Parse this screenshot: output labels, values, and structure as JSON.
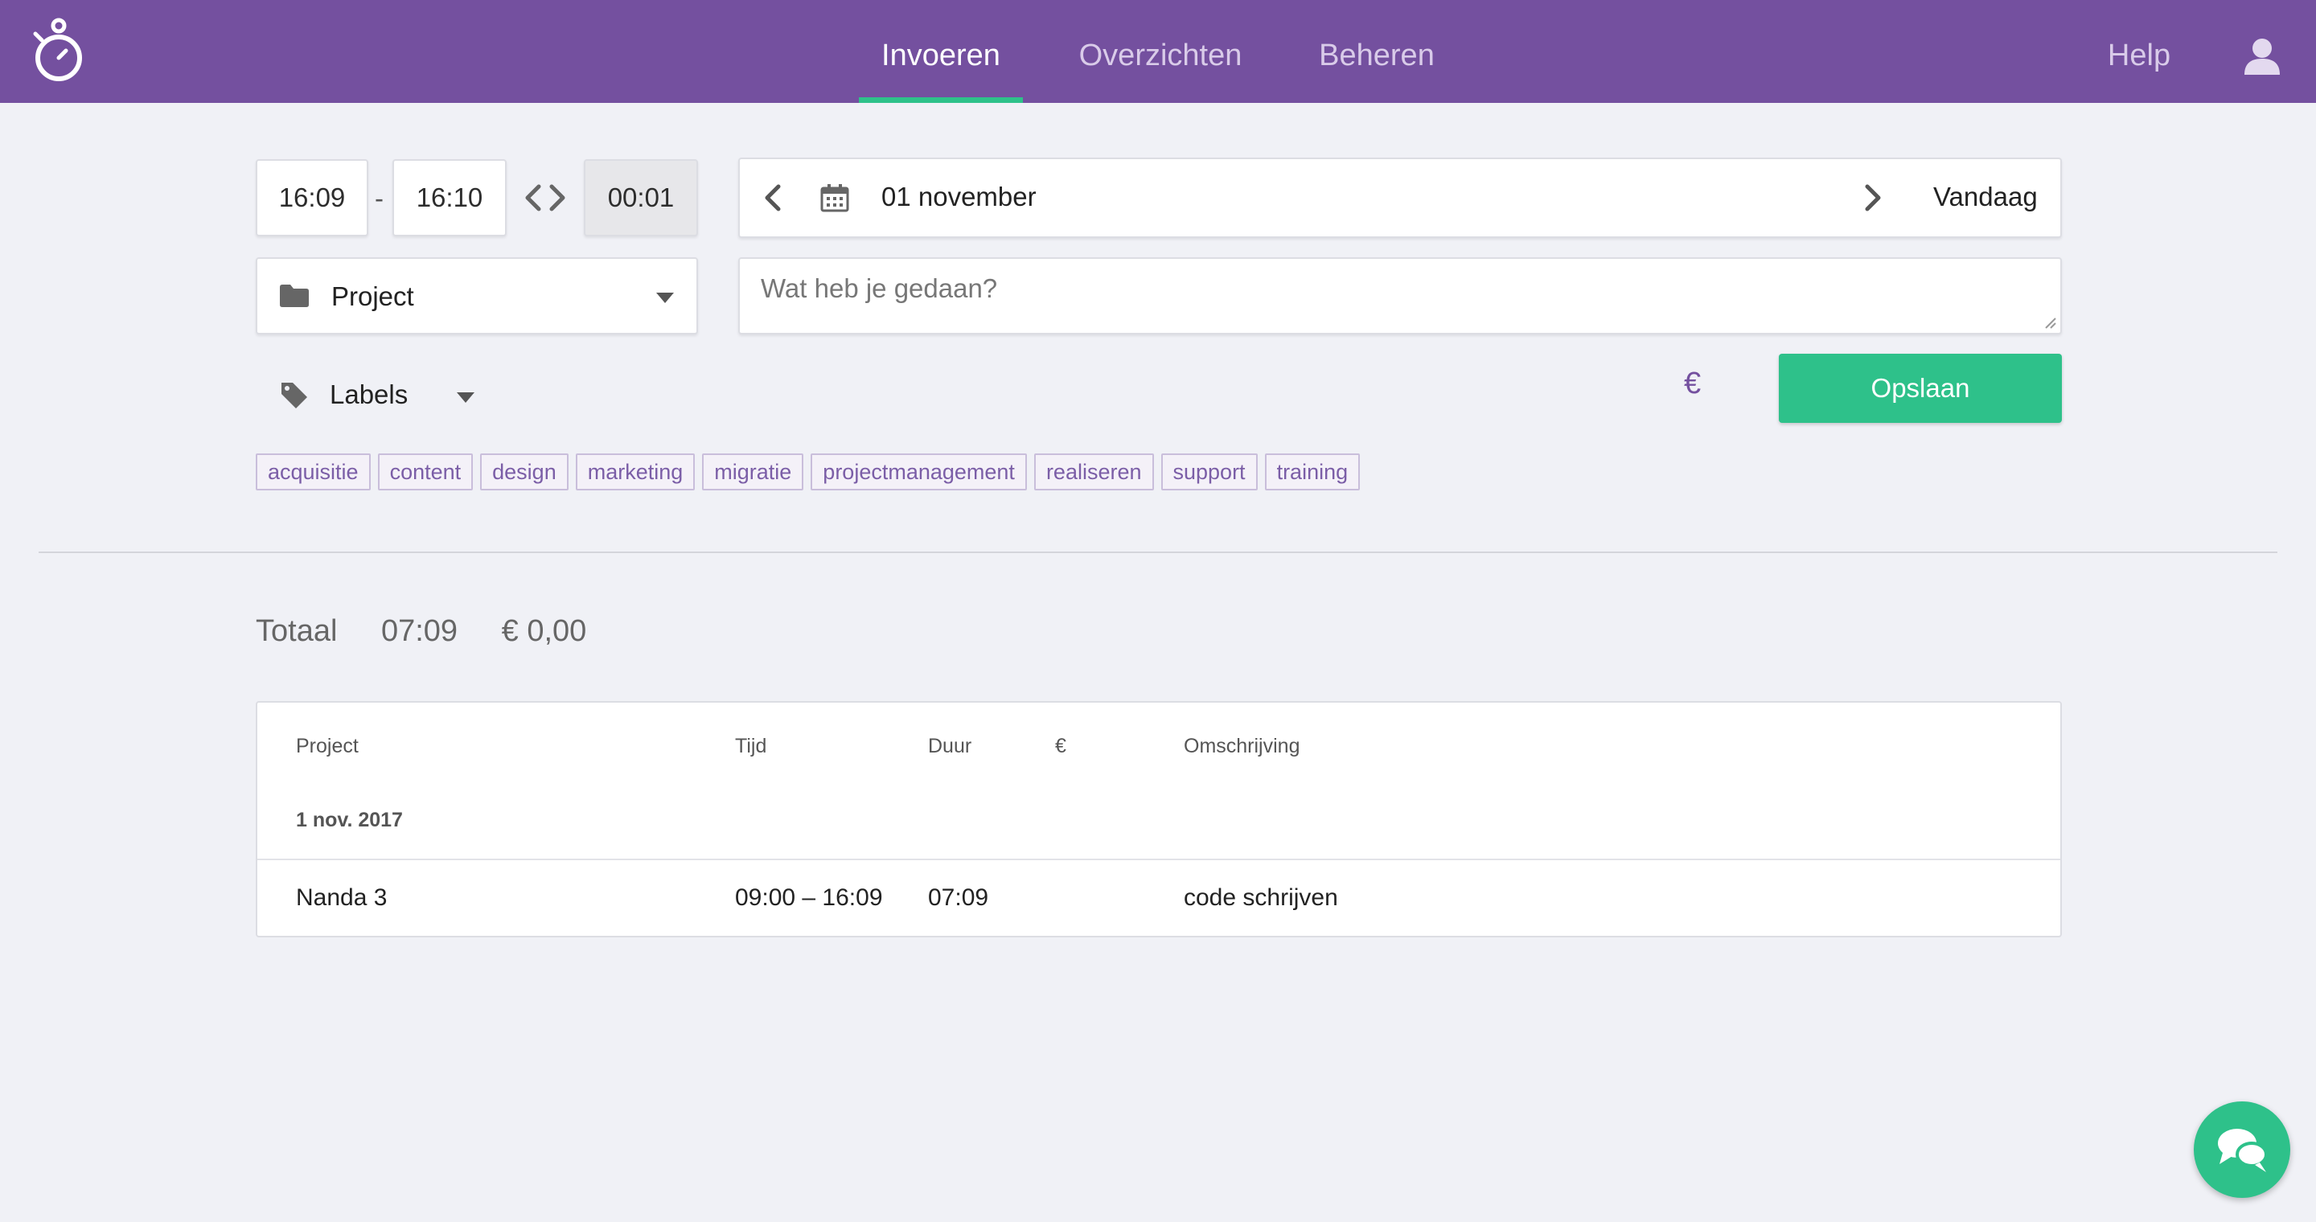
{
  "nav": {
    "items": [
      {
        "label": "Invoeren",
        "active": true
      },
      {
        "label": "Overzichten",
        "active": false
      },
      {
        "label": "Beheren",
        "active": false
      }
    ],
    "help_label": "Help",
    "logo_icon": "stopwatch-icon",
    "user_icon": "user-icon"
  },
  "form": {
    "start_time": "16:09",
    "separator": "-",
    "end_time": "16:10",
    "duration": "00:01",
    "date_label": "01 november",
    "today_label": "Vandaag",
    "project_label": "Project",
    "description_placeholder": "Wat heb je gedaan?",
    "labels_label": "Labels",
    "euro_symbol": "€",
    "save_label": "Opslaan",
    "tags": [
      "acquisitie",
      "content",
      "design",
      "marketing",
      "migratie",
      "projectmanagement",
      "realiseren",
      "support",
      "training"
    ]
  },
  "totals": {
    "label": "Totaal",
    "time": "07:09",
    "amount": "€ 0,00"
  },
  "table": {
    "headers": {
      "project": "Project",
      "tijd": "Tijd",
      "duur": "Duur",
      "euro": "€",
      "omschrijving": "Omschrijving"
    },
    "date_group": "1 nov. 2017",
    "rows": [
      {
        "project": "Nanda 3",
        "tijd": "09:00 – 16:09",
        "duur": "07:09",
        "euro": "",
        "omschrijving": "code schrijven"
      }
    ]
  },
  "colors": {
    "brand": "#74509f",
    "accent": "#2ec18a",
    "background": "#f0f1f6"
  }
}
